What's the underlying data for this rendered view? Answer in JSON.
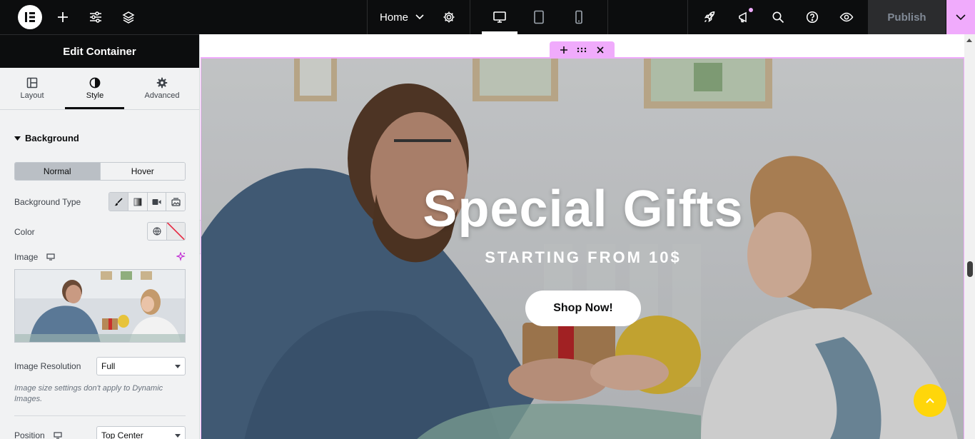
{
  "topbar": {
    "page_name": "Home",
    "publish_label": "Publish"
  },
  "panel": {
    "title": "Edit Container",
    "tabs": [
      {
        "label": "Layout"
      },
      {
        "label": "Style"
      },
      {
        "label": "Advanced"
      }
    ],
    "section_title": "Background",
    "state_toggle": {
      "normal": "Normal",
      "hover": "Hover"
    },
    "background_type_label": "Background Type",
    "color_label": "Color",
    "image_label": "Image",
    "image_resolution_label": "Image Resolution",
    "image_resolution_value": "Full",
    "image_note": "Image size settings don't apply to Dynamic Images.",
    "position_label": "Position",
    "position_value": "Top Center"
  },
  "hero": {
    "title": "Special Gifts",
    "subtitle": "STARTING FROM 10$",
    "button_label": "Shop Now!"
  },
  "colors": {
    "accent": "#f0abfc",
    "topbar_bg": "#0c0d0e",
    "panel_bg": "#f1f2f3",
    "fab": "#ffd60a"
  }
}
